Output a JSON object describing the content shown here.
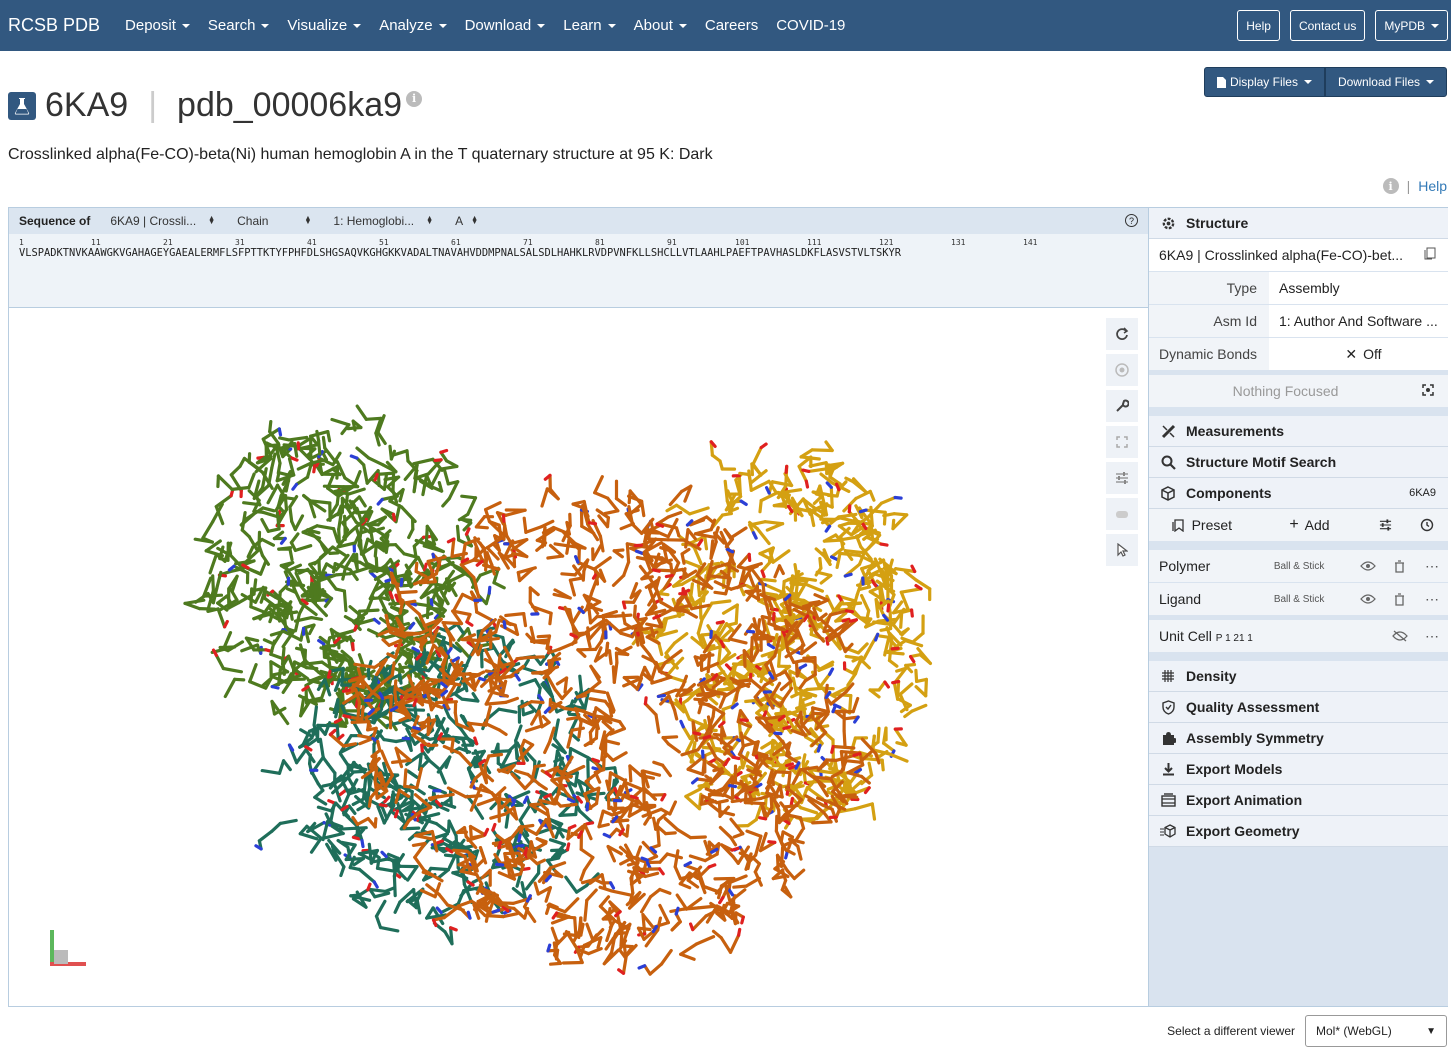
{
  "navbar": {
    "brand": "RCSB PDB",
    "items": [
      "Deposit",
      "Search",
      "Visualize",
      "Analyze",
      "Download",
      "Learn",
      "About",
      "Careers",
      "COVID-19"
    ],
    "right_buttons": [
      "Help",
      "Contact us",
      "MyPDB"
    ]
  },
  "header": {
    "pdb_id": "6KA9",
    "ext_id": "pdb_00006ka9",
    "subtitle": "Crosslinked alpha(Fe-CO)-beta(Ni) human hemoglobin A in the T quaternary structure at 95 K: Dark",
    "display_files": "Display Files",
    "download_files": "Download Files",
    "help": "Help"
  },
  "sequence": {
    "label": "Sequence of",
    "entry_select": "6KA9 | Crossli...",
    "mode_select": "Chain",
    "entity_select": "1: Hemoglobi...",
    "chain_select": "A",
    "numbers": [
      "1",
      "11",
      "21",
      "31",
      "41",
      "51",
      "61",
      "71",
      "81",
      "91",
      "101",
      "111",
      "121",
      "131",
      "141"
    ],
    "text": "VLSPADKTNVKAAWGKVGAHAGEYGAEALERMFLSFPTTKTYFPHFDLSHGSAQVKGHGKKVADALTNAVAHVDDMPNALSALSDLHAHKLRVDPVNFKLLSHCLLVTLAAHLPAEFTPAVHASLDKFLASVSTVLTSKYR"
  },
  "controls": {
    "structure": "Structure",
    "structure_name": "6KA9 | Crosslinked alpha(Fe-CO)-bet...",
    "type_label": "Type",
    "type_value": "Assembly",
    "asm_label": "Asm Id",
    "asm_value": "1: Author And Software ...",
    "dyn_label": "Dynamic Bonds",
    "dyn_value": "Off",
    "nothing_focused": "Nothing Focused",
    "measurements": "Measurements",
    "motif": "Structure Motif Search",
    "components": "Components",
    "components_id": "6KA9",
    "preset": "Preset",
    "add": "Add",
    "polymer": "Polymer",
    "polymer_rep": "Ball & Stick",
    "ligand": "Ligand",
    "ligand_rep": "Ball & Stick",
    "unit_cell": "Unit Cell",
    "unit_cell_sg": "P 1 21 1",
    "density": "Density",
    "quality": "Quality Assessment",
    "symmetry": "Assembly Symmetry",
    "export_models": "Export Models",
    "export_animation": "Export Animation",
    "export_geometry": "Export Geometry"
  },
  "footer": {
    "label": "Select a different viewer",
    "viewer": "Mol* (WebGL)"
  },
  "colors": {
    "nav": "#325880",
    "chain_green": "#4e7a1f",
    "chain_orange": "#c7600e",
    "chain_gold": "#d4a012",
    "chain_teal": "#1f6e5a"
  }
}
